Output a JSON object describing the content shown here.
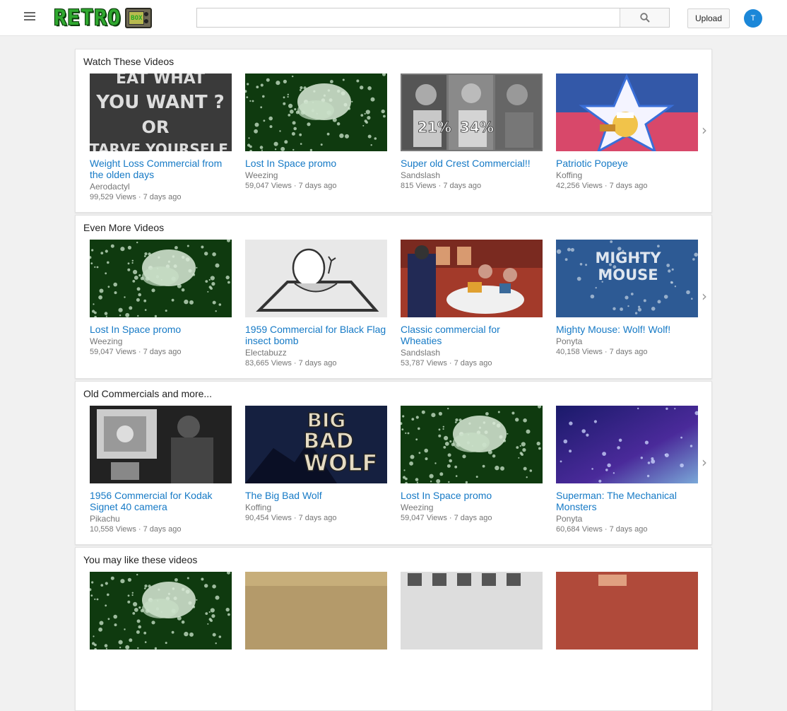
{
  "header": {
    "logo_text": "RETRO",
    "logo_badge": "BOX",
    "search_placeholder": "",
    "upload_label": "Upload",
    "avatar_initial": "T"
  },
  "colors": {
    "link": "#167ac6",
    "accent": "#1b87d8",
    "logo_green": "#2fa82f"
  },
  "sections": [
    {
      "title": "Watch These Videos",
      "videos": [
        {
          "title": "Weight Loss Commercial from the olden days",
          "channel": "Aerodactyl",
          "meta": "99,529 Views · 7 days ago",
          "thumb": "eat-what-you-want"
        },
        {
          "title": "Lost In Space promo",
          "channel": "Weezing",
          "meta": "59,047 Views · 7 days ago",
          "thumb": "lost-in-space"
        },
        {
          "title": "Super old Crest Commercial!!",
          "channel": "Sandslash",
          "meta": "815 Views · 7 days ago",
          "thumb": "crest"
        },
        {
          "title": "Patriotic Popeye",
          "channel": "Koffing",
          "meta": "42,256 Views · 7 days ago",
          "thumb": "popeye"
        }
      ]
    },
    {
      "title": "Even More Videos",
      "videos": [
        {
          "title": "Lost In Space promo",
          "channel": "Weezing",
          "meta": "59,047 Views · 7 days ago",
          "thumb": "lost-in-space"
        },
        {
          "title": "1959 Commercial for Black Flag insect bomb",
          "channel": "Electabuzz",
          "meta": "83,665 Views · 7 days ago",
          "thumb": "black-flag"
        },
        {
          "title": "Classic commercial for Wheaties",
          "channel": "Sandslash",
          "meta": "53,787 Views · 7 days ago",
          "thumb": "wheaties"
        },
        {
          "title": "Mighty Mouse: Wolf! Wolf!",
          "channel": "Ponyta",
          "meta": "40,158 Views · 7 days ago",
          "thumb": "mighty-mouse"
        }
      ]
    },
    {
      "title": "Old Commercials and more...",
      "videos": [
        {
          "title": "1956 Commercial for Kodak Signet 40 camera",
          "channel": "Pikachu",
          "meta": "10,558 Views · 7 days ago",
          "thumb": "kodak"
        },
        {
          "title": "The Big Bad Wolf",
          "channel": "Koffing",
          "meta": "90,454 Views · 7 days ago",
          "thumb": "big-bad-wolf"
        },
        {
          "title": "Lost In Space promo",
          "channel": "Weezing",
          "meta": "59,047 Views · 7 days ago",
          "thumb": "lost-in-space"
        },
        {
          "title": "Superman: The Mechanical Monsters",
          "channel": "Ponyta",
          "meta": "60,684 Views · 7 days ago",
          "thumb": "superman"
        }
      ]
    },
    {
      "title": "You may like these videos",
      "videos": [
        {
          "title": "",
          "channel": "",
          "meta": "",
          "thumb": "lost-in-space"
        },
        {
          "title": "",
          "channel": "",
          "meta": "",
          "thumb": "sepia"
        },
        {
          "title": "",
          "channel": "",
          "meta": "",
          "thumb": "bw-grid"
        },
        {
          "title": "",
          "channel": "",
          "meta": "",
          "thumb": "red-room"
        }
      ]
    }
  ],
  "thumb_text": {
    "eat-what-you-want": [
      "EAT WHAT",
      "YOU WANT ?",
      "OR",
      "STARVE YOURSELF ?"
    ],
    "crest": [
      "21%",
      "34%"
    ],
    "mighty-mouse": [
      "MIGHTY",
      "MOUSE"
    ],
    "big-bad-wolf": [
      "BIG",
      "BAD",
      "WOLF"
    ]
  }
}
